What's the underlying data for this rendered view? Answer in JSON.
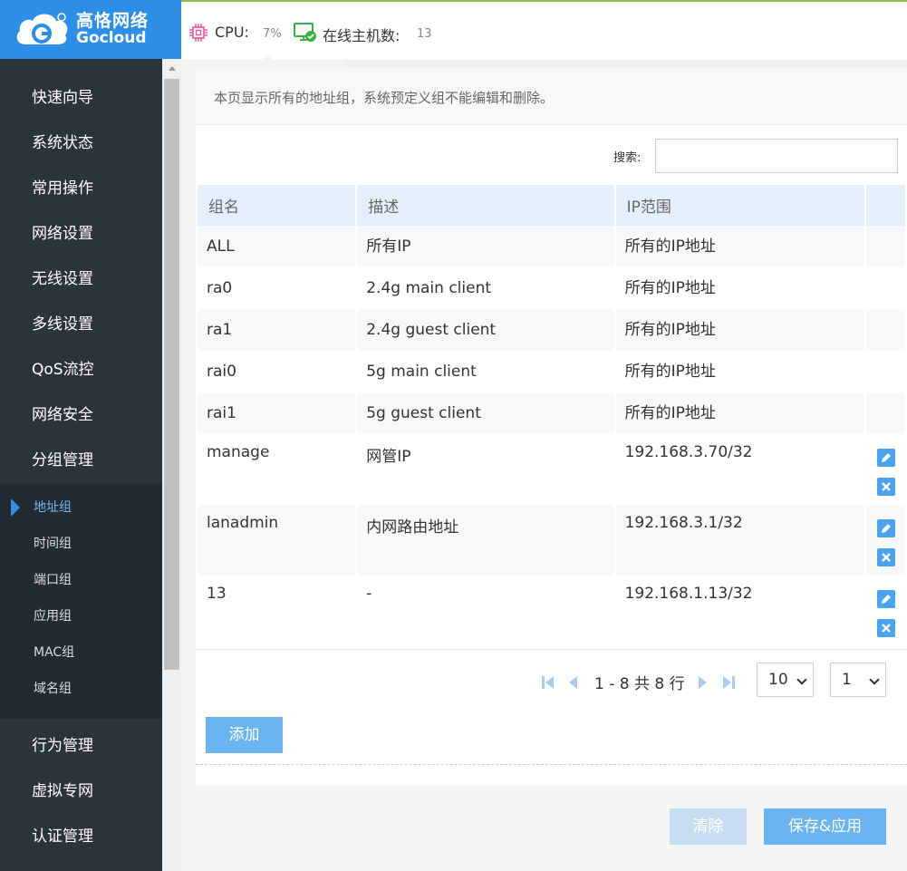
{
  "brand": {
    "name_cn": "高恪网络",
    "name_en": "Gocloud"
  },
  "topbar": {
    "cpu_label": "CPU:",
    "cpu_value": "7%",
    "hosts_label": "在线主机数:",
    "hosts_value": "13"
  },
  "sidebar": {
    "items": [
      {
        "label": "快速向导"
      },
      {
        "label": "系统状态"
      },
      {
        "label": "常用操作"
      },
      {
        "label": "网络设置"
      },
      {
        "label": "无线设置"
      },
      {
        "label": "多线设置"
      },
      {
        "label": "QoS流控"
      },
      {
        "label": "网络安全"
      },
      {
        "label": "分组管理"
      }
    ],
    "sub_items": [
      {
        "label": "地址组",
        "active": true
      },
      {
        "label": "时间组"
      },
      {
        "label": "端口组"
      },
      {
        "label": "应用组"
      },
      {
        "label": "MAC组"
      },
      {
        "label": "域名组"
      }
    ],
    "items_after": [
      {
        "label": "行为管理"
      },
      {
        "label": "虚拟专网"
      },
      {
        "label": "认证管理"
      }
    ]
  },
  "info": {
    "text": "本页显示所有的地址组，系统预定义组不能编辑和删除。"
  },
  "search": {
    "label": "搜索:",
    "value": "",
    "placeholder": ""
  },
  "table": {
    "headers": [
      "组名",
      "描述",
      "IP范围",
      ""
    ],
    "rows": [
      {
        "name": "ALL",
        "desc": "所有IP",
        "ip": "所有的IP地址"
      },
      {
        "name": "ra0",
        "desc": "2.4g main client",
        "ip": "所有的IP地址"
      },
      {
        "name": "ra1",
        "desc": "2.4g guest client",
        "ip": "所有的IP地址"
      },
      {
        "name": "rai0",
        "desc": "5g main client",
        "ip": "所有的IP地址"
      },
      {
        "name": "rai1",
        "desc": "5g guest client",
        "ip": "所有的IP地址"
      },
      {
        "name": "manage",
        "desc": "网管IP",
        "ip": "192.168.3.70/32"
      },
      {
        "name": "lanadmin",
        "desc": "内网路由地址",
        "ip": "192.168.3.1/32"
      },
      {
        "name": "13",
        "desc": "-",
        "ip": "192.168.1.13/32"
      }
    ]
  },
  "pager": {
    "summary": "1 - 8 共 8 行",
    "page_size": "10",
    "page": "1"
  },
  "buttons": {
    "add": "添加",
    "clear": "清除",
    "save": "保存&应用"
  },
  "colors": {
    "brand_blue": "#2c8ee6",
    "sidebar_bg": "#2b333c",
    "button_blue": "#6ab4f0",
    "header_bg": "#e3effa"
  }
}
